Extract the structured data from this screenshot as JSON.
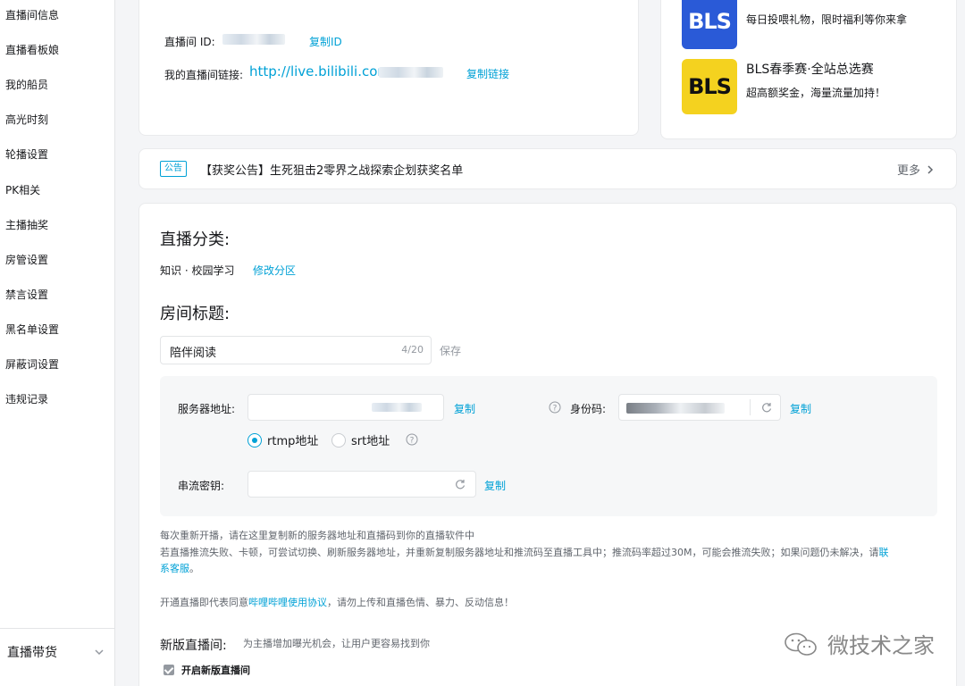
{
  "sidebar": {
    "items": [
      "直播间信息",
      "直播看板娘",
      "我的船员",
      "高光时刻",
      "轮播设置",
      "PK相关",
      "主播抽奖",
      "房管设置",
      "禁言设置",
      "黑名单设置",
      "屏蔽词设置",
      "违规记录"
    ],
    "bottom_label": "直播带货"
  },
  "room_info": {
    "room_id_label": "直播间 ID:",
    "copy_id_label": "复制ID",
    "link_label": "我的直播间链接:",
    "link_value": "http://live.bilibili.com.",
    "copy_link_label": "复制链接"
  },
  "promos": [
    {
      "thumb": "BLS",
      "title": "",
      "subtitle": "每日投喂礼物，限时福利等你来拿"
    },
    {
      "thumb": "BLS",
      "title": "BLS春季赛·全站总选赛",
      "subtitle": "超高额奖金，海量流量加持！"
    }
  ],
  "notice": {
    "tag": "公告",
    "text": "【获奖公告】生死狙击2零界之战探索企划获奖名单",
    "more": "更多"
  },
  "category": {
    "heading": "直播分类:",
    "value": "知识 · 校园学习",
    "edit_label": "修改分区"
  },
  "room_title": {
    "heading": "房间标题:",
    "value": "陪伴阅读",
    "count": "4/20",
    "save_label": "保存"
  },
  "stream": {
    "server_label": "服务器地址:",
    "copy_label": "复制",
    "identity_label": "身份码:",
    "identity_copy_label": "复制",
    "radio_rtmp": "rtmp地址",
    "radio_srt": "srt地址",
    "key_label": "串流密钥:",
    "key_copy_label": "复制"
  },
  "tips": {
    "line1": "每次重新开播，请在这里复制新的服务器地址和直播码到你的直播软件中",
    "line2_prefix": "若直播推流失败、卡顿，可尝试切换、刷新服务器地址，并重新复制服务器地址和推流码至直播工具中；推流码率超过30M，可能会推流失败；如果问题仍未解决，请",
    "line2_link": "联",
    "line3_link": "系客服",
    "line3_suffix": "。",
    "agreement_prefix": "开通直播即代表同意",
    "agreement_link": "哔哩哔哩使用协议",
    "agreement_suffix": "，请勿上传和直播色情、暴力、反动信息！"
  },
  "new_room": {
    "heading": "新版直播间:",
    "desc": "为主播增加曝光机会，让用户更容易找到你",
    "checkbox_label": "开启新版直播间"
  },
  "watermark": {
    "text": "微技术之家"
  },
  "colors": {
    "accent": "#00a1d6",
    "background": "#f4f5f7"
  }
}
